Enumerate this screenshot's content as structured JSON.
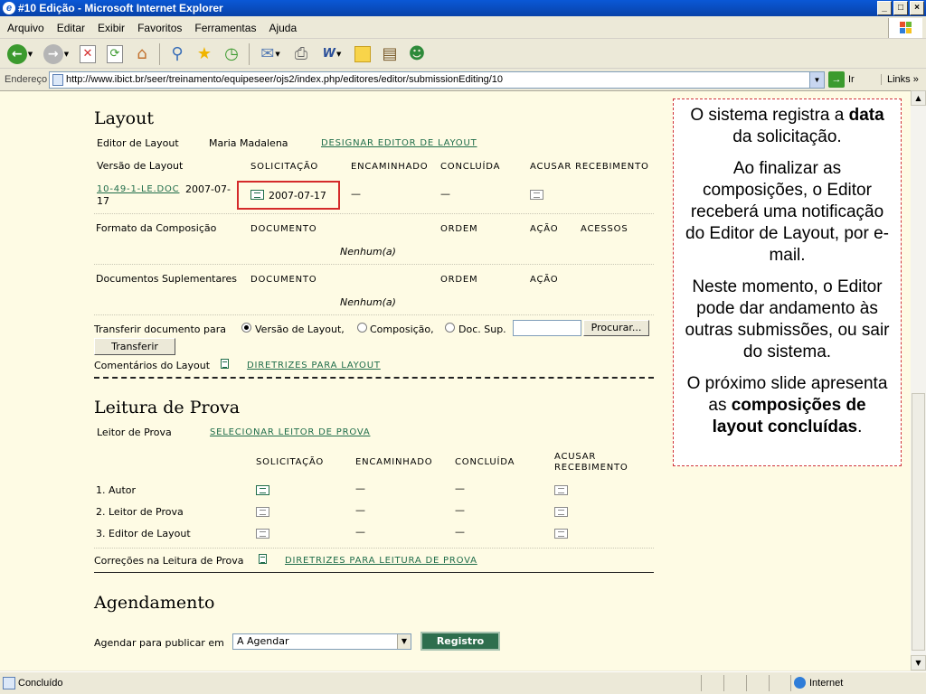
{
  "window": {
    "title": "#10 Edição - Microsoft Internet Explorer"
  },
  "menu": [
    "Arquivo",
    "Editar",
    "Exibir",
    "Favoritos",
    "Ferramentas",
    "Ajuda"
  ],
  "address": {
    "label": "Endereço",
    "url": "http://www.ibict.br/seer/treinamento/equipeseer/ojs2/index.php/editores/editor/submissionEditing/10",
    "go": "Ir",
    "links": "Links »"
  },
  "status": {
    "text": "Concluído",
    "zone": "Internet"
  },
  "layout": {
    "title": "Layout",
    "editor_label": "Editor de Layout",
    "editor_name": "Maria Madalena",
    "assign_link": "DESIGNAR EDITOR DE LAYOUT",
    "version_label": "Versão de Layout",
    "cols": [
      "SOLICITAÇÃO",
      "ENCAMINHADO",
      "CONCLUÍDA",
      "ACUSAR RECEBIMENTO"
    ],
    "file_link": "10-49-1-LE.DOC",
    "file_date_a": "2007-07-",
    "file_date_b": "17",
    "request_date": "2007-07-17",
    "dash": "—",
    "format_label": "Formato da Composição",
    "format_cols": [
      "DOCUMENTO",
      "ORDEM",
      "AÇÃO",
      "ACESSOS"
    ],
    "none": "Nenhum(a)",
    "supp_label": "Documentos Suplementares",
    "supp_cols": [
      "DOCUMENTO",
      "ORDEM",
      "AÇÃO"
    ],
    "transfer_label": "Transferir documento para",
    "radio_options": [
      "Versão de Layout,",
      "Composição,",
      "Doc. Sup."
    ],
    "browse": "Procurar...",
    "transfer_btn": "Transferir",
    "comments_label": "Comentários do Layout",
    "guidelines_link": "DIRETRIZES PARA LAYOUT"
  },
  "proof": {
    "title": "Leitura de Prova",
    "reader_label": "Leitor de Prova",
    "select_link": "SELECIONAR LEITOR DE PROVA",
    "cols": [
      "SOLICITAÇÃO",
      "ENCAMINHADO",
      "CONCLUÍDA",
      "ACUSAR",
      "RECEBIMENTO"
    ],
    "rows": [
      "1.  Autor",
      "2.  Leitor de Prova",
      "3.  Editor de Layout"
    ],
    "corrections_label": "Correções na Leitura de Prova",
    "guidelines_link": "DIRETRIZES PARA LEITURA DE PROVA"
  },
  "schedule": {
    "title": "Agendamento",
    "label": "Agendar para publicar em",
    "select_value": "A Agendar",
    "record_btn": "Registro"
  },
  "note": {
    "p1_a": "O sistema registra a ",
    "p1_b": "data",
    "p1_c": " da solicitação.",
    "p2": "Ao finalizar as composições, o Editor receberá uma notificação do Editor de Layout, por e-mail.",
    "p3": "Neste momento, o Editor pode dar andamento às outras submissões, ou sair do sistema.",
    "p4_a": "O próximo slide apresenta as ",
    "p4_b": "composições de layout concluídas",
    "p4_c": "."
  }
}
